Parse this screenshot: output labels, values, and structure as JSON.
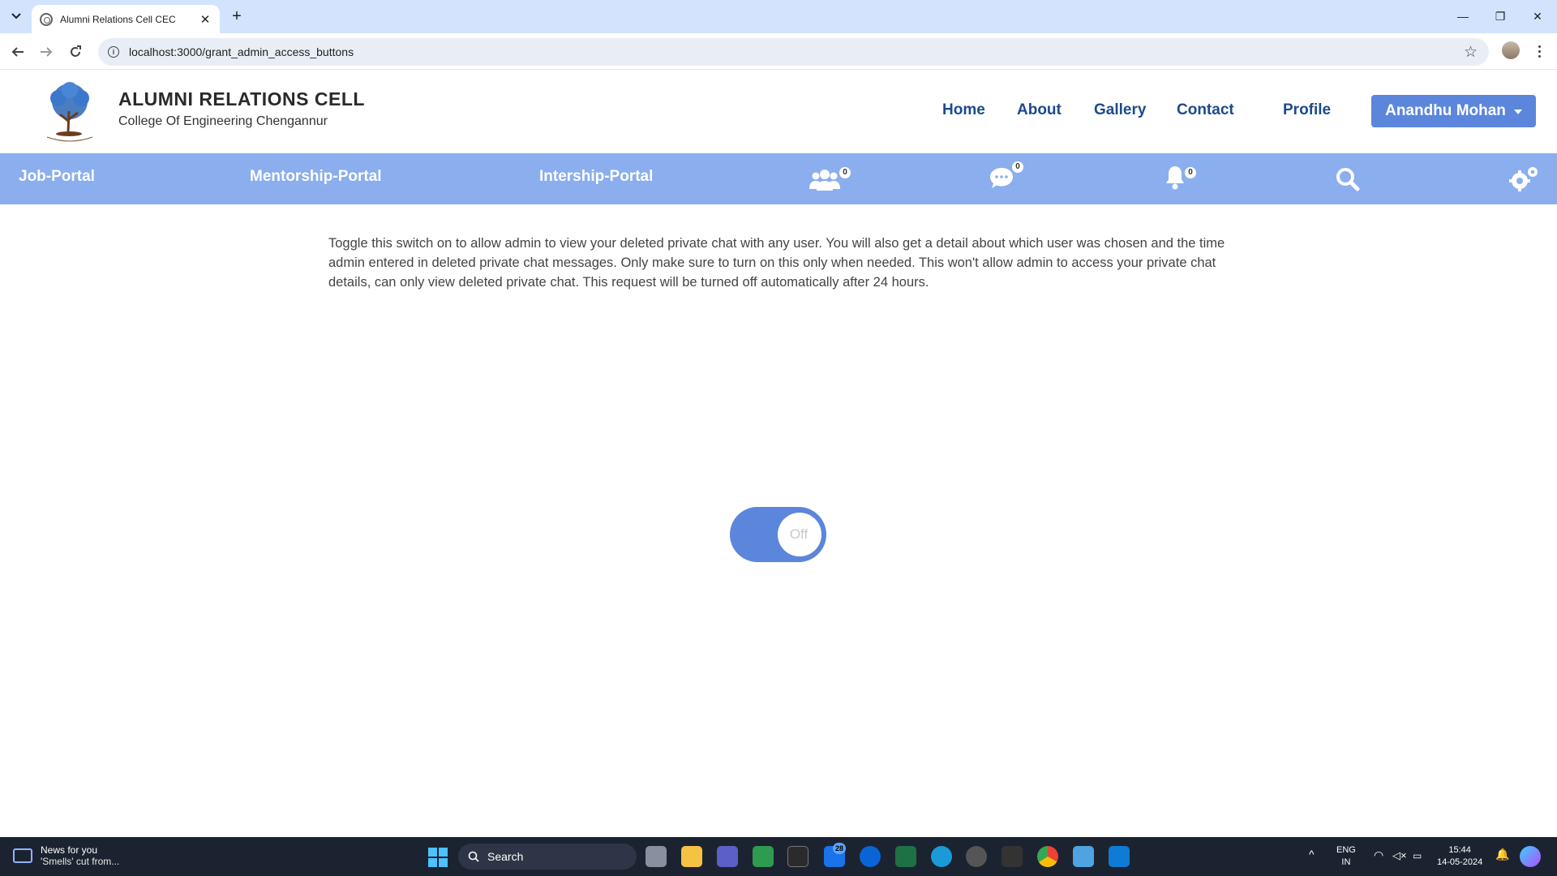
{
  "browser": {
    "tab_title": "Alumni Relations Cell CEC",
    "url": "localhost:3000/grant_admin_access_buttons"
  },
  "site": {
    "title": "ALUMNI RELATIONS CELL",
    "subtitle": "College Of Engineering Chengannur",
    "nav": {
      "home": "Home",
      "about": "About",
      "gallery": "Gallery",
      "contact": "Contact",
      "profile": "Profile"
    },
    "user_name": "Anandhu Mohan"
  },
  "portal_bar": {
    "job": "Job-Portal",
    "mentorship": "Mentorship-Portal",
    "internship": "Intership-Portal",
    "groups_count": "0",
    "messages_count": "0",
    "notifications_count": "0"
  },
  "content": {
    "notice": "Toggle this switch on to allow admin to view your deleted private chat with any user. You will also get a detail about which user was chosen and the time admin entered in deleted private chat messages. Only make sure to turn on this only when needed. This won't allow admin to access your private chat details, can only view deleted private chat. This request will be turned off automatically after 24 hours.",
    "toggle_label": "Off"
  },
  "taskbar": {
    "news_title": "News for you",
    "news_sub": "'Smells' cut from...",
    "search_label": "Search",
    "mail_badge": "28",
    "lang": "ENG",
    "region": "IN",
    "time": "15:44",
    "date": "14-05-2024"
  },
  "colors": {
    "accent": "#5b86db",
    "portal_bar": "#8aaeee",
    "nav_text": "#1e4a8c"
  }
}
